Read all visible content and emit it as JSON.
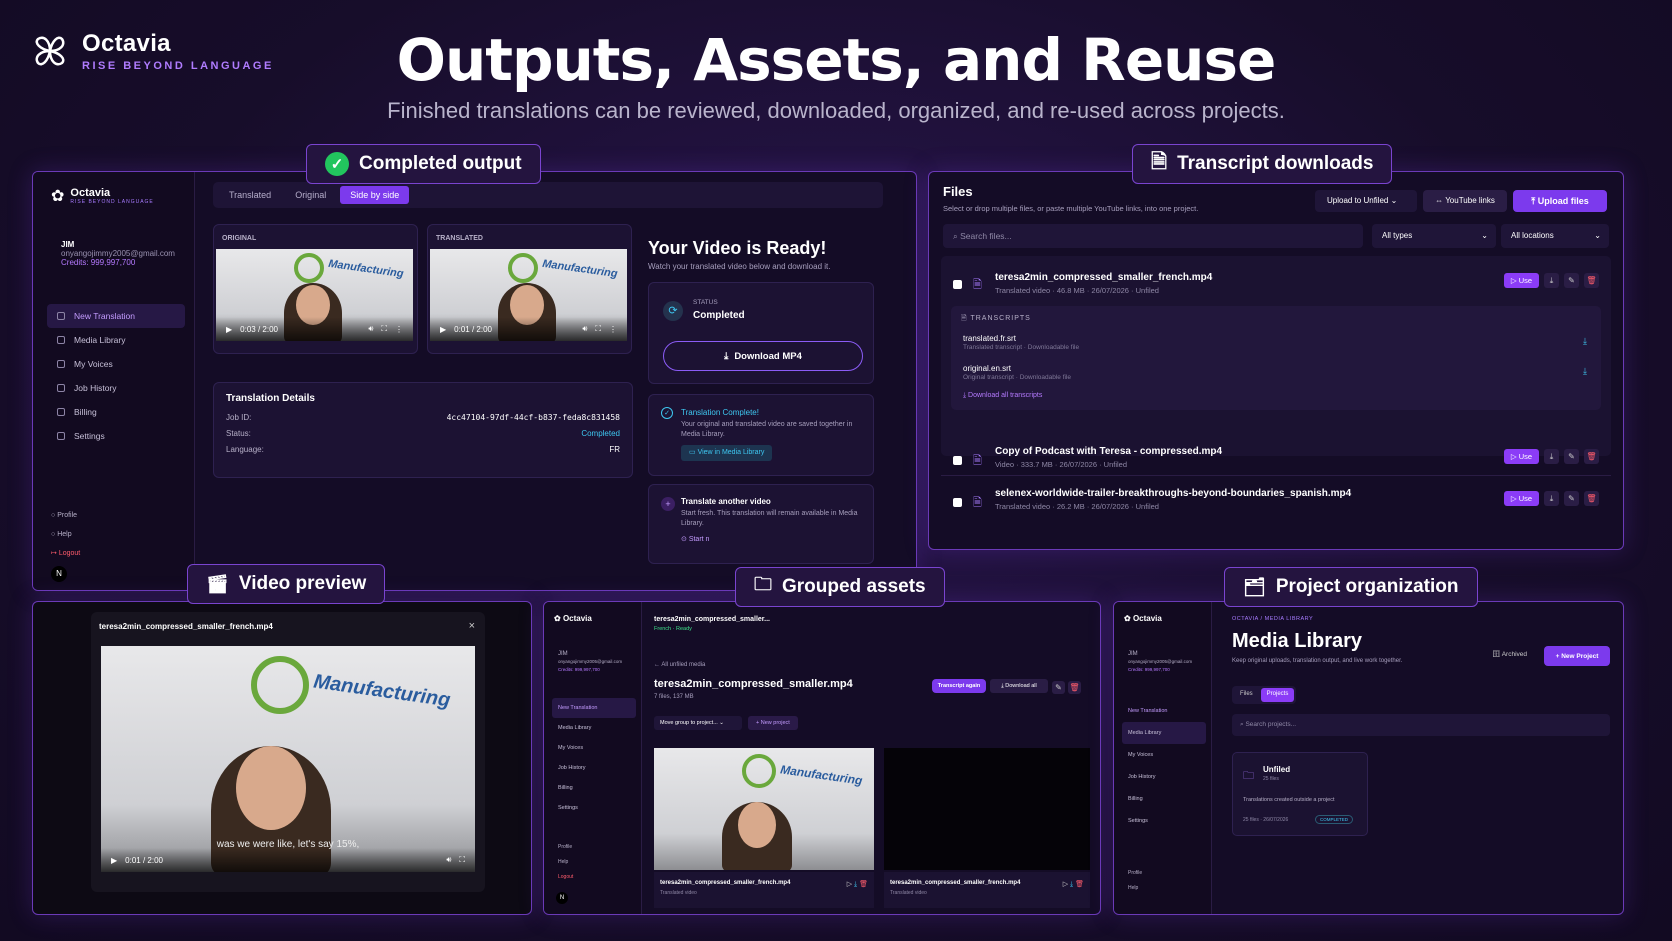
{
  "brand": {
    "name": "Octavia",
    "tagline": "RISE BEYOND LANGUAGE"
  },
  "headline": "Outputs, Assets, and Reuse",
  "subline": "Finished translations can be reviewed, downloaded, organized, and re-used across projects.",
  "badges": {
    "completed": "Completed output",
    "transcripts": "Transcript downloads",
    "video": "Video preview",
    "grouped": "Grouped assets",
    "projects": "Project organization"
  },
  "completed": {
    "brand": "Octavia",
    "tag": "RISE BEYOND LANGUAGE",
    "user": {
      "name": "JIM",
      "email": "onyangojimmy2005@gmail.com",
      "credits": "Credits: 999,997,700"
    },
    "nav": [
      "New Translation",
      "Media Library",
      "My Voices",
      "Job History",
      "Billing",
      "Settings"
    ],
    "bottom_nav": [
      "Profile",
      "Help",
      "Logout"
    ],
    "avatar": "N",
    "tabs": [
      "Translated",
      "Original",
      "Side by side"
    ],
    "orig_label": "ORIGINAL",
    "trans_label": "TRANSLATED",
    "orig_time": "0:03 / 2:00",
    "trans_time": "0:01 / 2:00",
    "details": {
      "title": "Translation Details",
      "job_label": "Job ID:",
      "job": "4cc47104-97df-44cf-b837-feda8c831458",
      "status_label": "Status:",
      "status": "Completed",
      "lang_label": "Language:",
      "lang": "FR"
    },
    "ready_title": "Your Video is Ready!",
    "ready_sub": "Watch your translated video below and download it.",
    "status_small": "STATUS",
    "status_val": "Completed",
    "download": "Download MP4",
    "complete_title": "Translation Complete!",
    "complete_text": "Your original and translated video are saved together in Media Library.",
    "view_media": "View in Media Library",
    "another_title": "Translate another video",
    "another_text": "Start fresh. This translation will remain available in Media Library.",
    "start": "Start n"
  },
  "files": {
    "title": "Files",
    "sub": "Select or drop multiple files, or paste multiple YouTube links, into one project.",
    "upload_to": "Upload to Unfiled",
    "yt": "YouTube links",
    "upload": "Upload files",
    "search": "Search files...",
    "types": "All types",
    "locations": "All locations",
    "rows": [
      {
        "name": "teresa2min_compressed_smaller_french.mp4",
        "meta": "Translated video · 46.8 MB · 26/07/2026 · Unfiled"
      },
      {
        "name": "Copy of Podcast with Teresa - compressed.mp4",
        "meta": "Video · 333.7 MB · 26/07/2026 · Unfiled"
      },
      {
        "name": "selenex-worldwide-trailer-breakthroughs-beyond-boundaries_spanish.mp4",
        "meta": "Translated video · 26.2 MB · 26/07/2026 · Unfiled"
      }
    ],
    "transcripts_label": "TRANSCRIPTS",
    "t1": "translated.fr.srt",
    "t1m": "Translated transcript · Downloadable file",
    "t2": "original.en.srt",
    "t2m": "Original transcript · Downloadable file",
    "dl_all": "Download all transcripts",
    "use": "Use"
  },
  "preview": {
    "title": "teresa2min_compressed_smaller_french.mp4",
    "time": "0:01 / 2:00",
    "caption": "was we were like, let's say 15%,"
  },
  "grouped": {
    "tab": "teresa2min_compressed_smaller...",
    "tab_sub": "French · Ready",
    "back": "← All unfiled media",
    "title": "teresa2min_compressed_smaller.mp4",
    "meta": "7 files, 137 MB",
    "again": "Transcript again",
    "dl_all": "Download all",
    "move": "Move group to project...",
    "newp": "+ New project",
    "c1": "teresa2min_compressed_smaller_french.mp4",
    "c2": "teresa2min_compressed_smaller_french.mp4",
    "c_meta": "Translated video"
  },
  "library": {
    "crumb": "OCTAVIA / MEDIA LIBRARY",
    "title": "Media Library",
    "sub": "Keep original uploads, translation output, and live work together.",
    "archived": "Archived",
    "newp": "+ New Project",
    "tab1": "Files",
    "tab2": "Projects",
    "search": "Search projects...",
    "folder": "Unfiled",
    "folder_meta": "25 files",
    "folder_desc": "Translations created outside a project",
    "folder_foot": "25 files · 26/07/2026",
    "folder_badge": "COMPLETED"
  }
}
